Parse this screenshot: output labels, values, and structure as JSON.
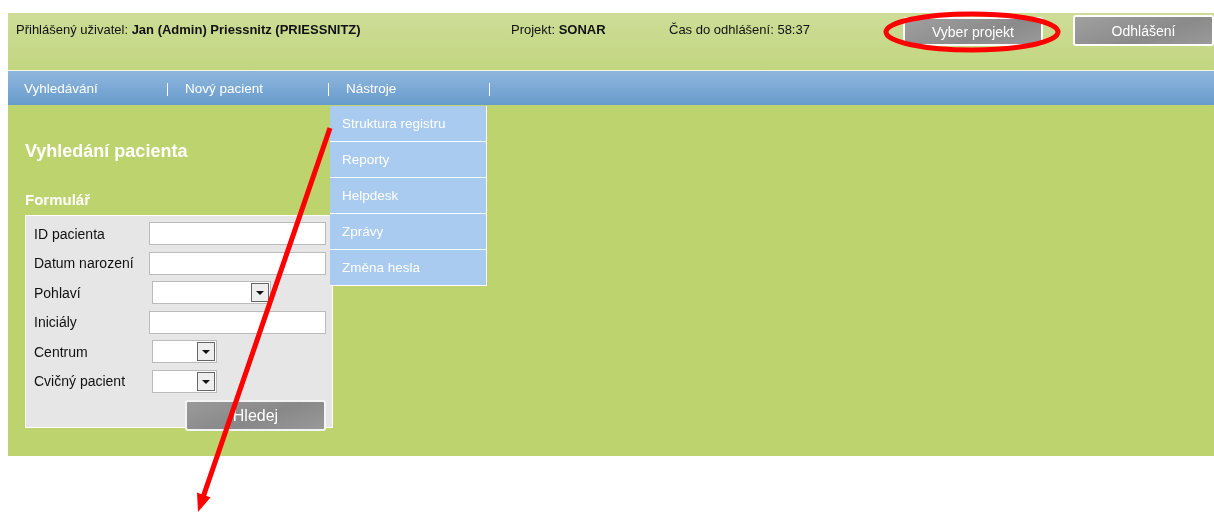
{
  "header": {
    "user": "Přihlášený uživatel: **Jan (Admin) Priessnitz (PRIESSNITZ)**",
    "project": "Projekt: **SONAR**",
    "timeout": "Čas do odhlášení: 58:37",
    "buttons": [
      "Vyber projekt",
      "Odhlášení"
    ]
  },
  "nav": {
    "items": [
      {
        "label": "Vyhledávání"
      },
      {
        "label": "Nový pacient"
      },
      {
        "label": "Nástroje",
        "menu": [
          "Struktura registru",
          "Reporty",
          "Helpdesk",
          "Zprávy",
          "Změna hesla"
        ]
      }
    ]
  },
  "page": {
    "title": "Vyhledání pacienta",
    "section": "Formulář"
  },
  "form": {
    "fields": [
      {
        "label": "ID pacienta",
        "kind": "text"
      },
      {
        "label": "Datum narození",
        "kind": "text"
      },
      {
        "label": "Pohlaví",
        "kind": "select"
      },
      {
        "label": "Iniciály",
        "kind": "text"
      },
      {
        "label": "Centrum",
        "kind": "select"
      },
      {
        "label": "Cvičný pacient",
        "kind": "select"
      }
    ],
    "submit": "Hledej"
  },
  "annotations": [
    {
      "kind": "ellipse"
    },
    {
      "kind": "arrow"
    }
  ]
}
